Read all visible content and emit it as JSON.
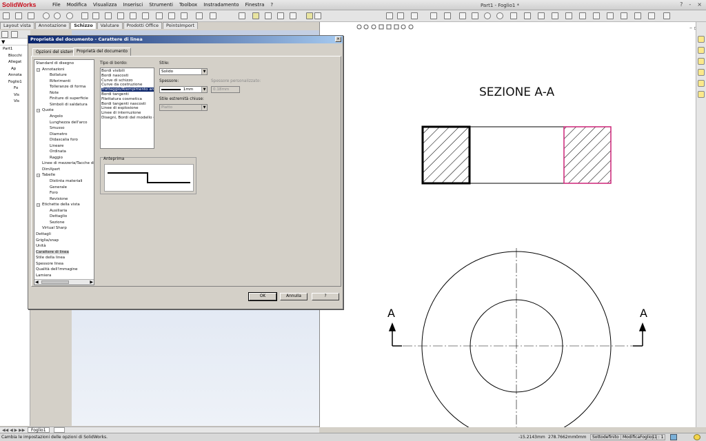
{
  "app": {
    "logo": "SolidWorks",
    "window_title": "Part1 - Foglio1 *",
    "menu": [
      "File",
      "Modifica",
      "Visualizza",
      "Inserisci",
      "Strumenti",
      "Toolbox",
      "Instradamento",
      "Finestra",
      "?"
    ],
    "window_controls": [
      "?",
      "-",
      "×"
    ]
  },
  "command_tabs": [
    {
      "label": "Layout vista",
      "active": false
    },
    {
      "label": "Annotazione",
      "active": false
    },
    {
      "label": "Schizzo",
      "active": true
    },
    {
      "label": "Valutare",
      "active": false
    },
    {
      "label": "Prodotti Office",
      "active": false
    },
    {
      "label": "PointsImport",
      "active": false
    }
  ],
  "feature_tree": [
    {
      "label": "Part1"
    },
    {
      "label": "Blocchi"
    },
    {
      "label": "Allegat"
    },
    {
      "label": "Ap"
    },
    {
      "label": "Annota"
    },
    {
      "label": "Foglio1"
    },
    {
      "label": "Fo"
    },
    {
      "label": "Vis"
    },
    {
      "label": "Vis"
    }
  ],
  "dialog": {
    "title": "Proprietà del documento - Carattere di linea",
    "close": "×",
    "tabs": [
      {
        "label": "Opzioni del sistema",
        "active": false
      },
      {
        "label": "Proprietà del documento",
        "active": true
      }
    ],
    "options_tree": [
      {
        "label": "Standard di disegno",
        "level": 0,
        "expander": ""
      },
      {
        "label": "Annotazioni",
        "level": 1,
        "expander": "−"
      },
      {
        "label": "Bollature",
        "level": 2,
        "expander": ""
      },
      {
        "label": "Riferimenti",
        "level": 2,
        "expander": ""
      },
      {
        "label": "Tolleranze di forma",
        "level": 2,
        "expander": ""
      },
      {
        "label": "Note",
        "level": 2,
        "expander": ""
      },
      {
        "label": "Finiture di superficie",
        "level": 2,
        "expander": ""
      },
      {
        "label": "Simboli di saldatura",
        "level": 2,
        "expander": ""
      },
      {
        "label": "Quote",
        "level": 1,
        "expander": "−"
      },
      {
        "label": "Angolo",
        "level": 2,
        "expander": ""
      },
      {
        "label": "Lunghezza dell'arco",
        "level": 2,
        "expander": ""
      },
      {
        "label": "Smusso",
        "level": 2,
        "expander": ""
      },
      {
        "label": "Diametro",
        "level": 2,
        "expander": ""
      },
      {
        "label": "Didascalia foro",
        "level": 2,
        "expander": ""
      },
      {
        "label": "Lineare",
        "level": 2,
        "expander": ""
      },
      {
        "label": "Ordinata",
        "level": 2,
        "expander": ""
      },
      {
        "label": "Raggio",
        "level": 2,
        "expander": ""
      },
      {
        "label": "Linee di mezzeria/Tacche di c",
        "level": 1,
        "expander": ""
      },
      {
        "label": "DimXpert",
        "level": 1,
        "expander": ""
      },
      {
        "label": "Tabelle",
        "level": 1,
        "expander": "−"
      },
      {
        "label": "Distinta materiali",
        "level": 2,
        "expander": ""
      },
      {
        "label": "Generale",
        "level": 2,
        "expander": ""
      },
      {
        "label": "Foro",
        "level": 2,
        "expander": ""
      },
      {
        "label": "Revisione",
        "level": 2,
        "expander": ""
      },
      {
        "label": "Etichette della vista",
        "level": 1,
        "expander": "−"
      },
      {
        "label": "Ausiliaria",
        "level": 2,
        "expander": ""
      },
      {
        "label": "Dettaglio",
        "level": 2,
        "expander": ""
      },
      {
        "label": "Sezione",
        "level": 2,
        "expander": ""
      },
      {
        "label": "Virtual Sharp",
        "level": 1,
        "expander": ""
      },
      {
        "label": "Dettagli",
        "level": 0,
        "expander": ""
      },
      {
        "label": "Griglia/snap",
        "level": 0,
        "expander": ""
      },
      {
        "label": "Unità",
        "level": 0,
        "expander": ""
      },
      {
        "label": "Carattere di linea",
        "level": 0,
        "expander": "",
        "selected": true
      },
      {
        "label": "Stile della linea",
        "level": 0,
        "expander": ""
      },
      {
        "label": "Spessore linea",
        "level": 0,
        "expander": ""
      },
      {
        "label": "Qualità dell'immagine",
        "level": 0,
        "expander": ""
      },
      {
        "label": "Lamiera",
        "level": 0,
        "expander": ""
      }
    ],
    "border_type": {
      "label": "Tipo di bordo:",
      "items": [
        {
          "label": "Bordi visibili"
        },
        {
          "label": "Bordi nascosti"
        },
        {
          "label": "Curve di schizzo"
        },
        {
          "label": "Curve da costruzione"
        },
        {
          "label": "Tratteggio/Riempimento area",
          "selected": true
        },
        {
          "label": "Bordi tangenti"
        },
        {
          "label": "Filettatura cosmetica"
        },
        {
          "label": "Bordi tangenti nascosti"
        },
        {
          "label": "Linee di esplosione"
        },
        {
          "label": "Linee di interruzione"
        },
        {
          "label": "Disegni, Bordi del modello (Spe"
        }
      ]
    },
    "style": {
      "label": "Stile:",
      "value": "Solido"
    },
    "thickness": {
      "label": "Spessore:",
      "value": "1mm"
    },
    "custom_thickness": {
      "label": "Spessore personalizzato:",
      "value": "0.18mm"
    },
    "end_style": {
      "label": "Stile estremità chiuse:",
      "value": "Piatto"
    },
    "preview_label": "Anteprima",
    "buttons": {
      "ok": "OK",
      "cancel": "Annulla",
      "help": "?"
    }
  },
  "drawing": {
    "section_title": "SEZIONE A-A",
    "cut_label_left": "A",
    "cut_label_right": "A",
    "colors": {
      "selected_hatch": "#cc2277",
      "hatch": "#000000"
    }
  },
  "sheet_tab": "Foglio1",
  "status": {
    "message": "Cambia le impostazioni delle opzioni di SolidWorks.",
    "x": "-15.2143mm",
    "y": "278.7662mm",
    "z": "0mm",
    "state": "Sottodefinito",
    "edit": "ModificaFoglio1",
    "scale": "1 : 1"
  }
}
